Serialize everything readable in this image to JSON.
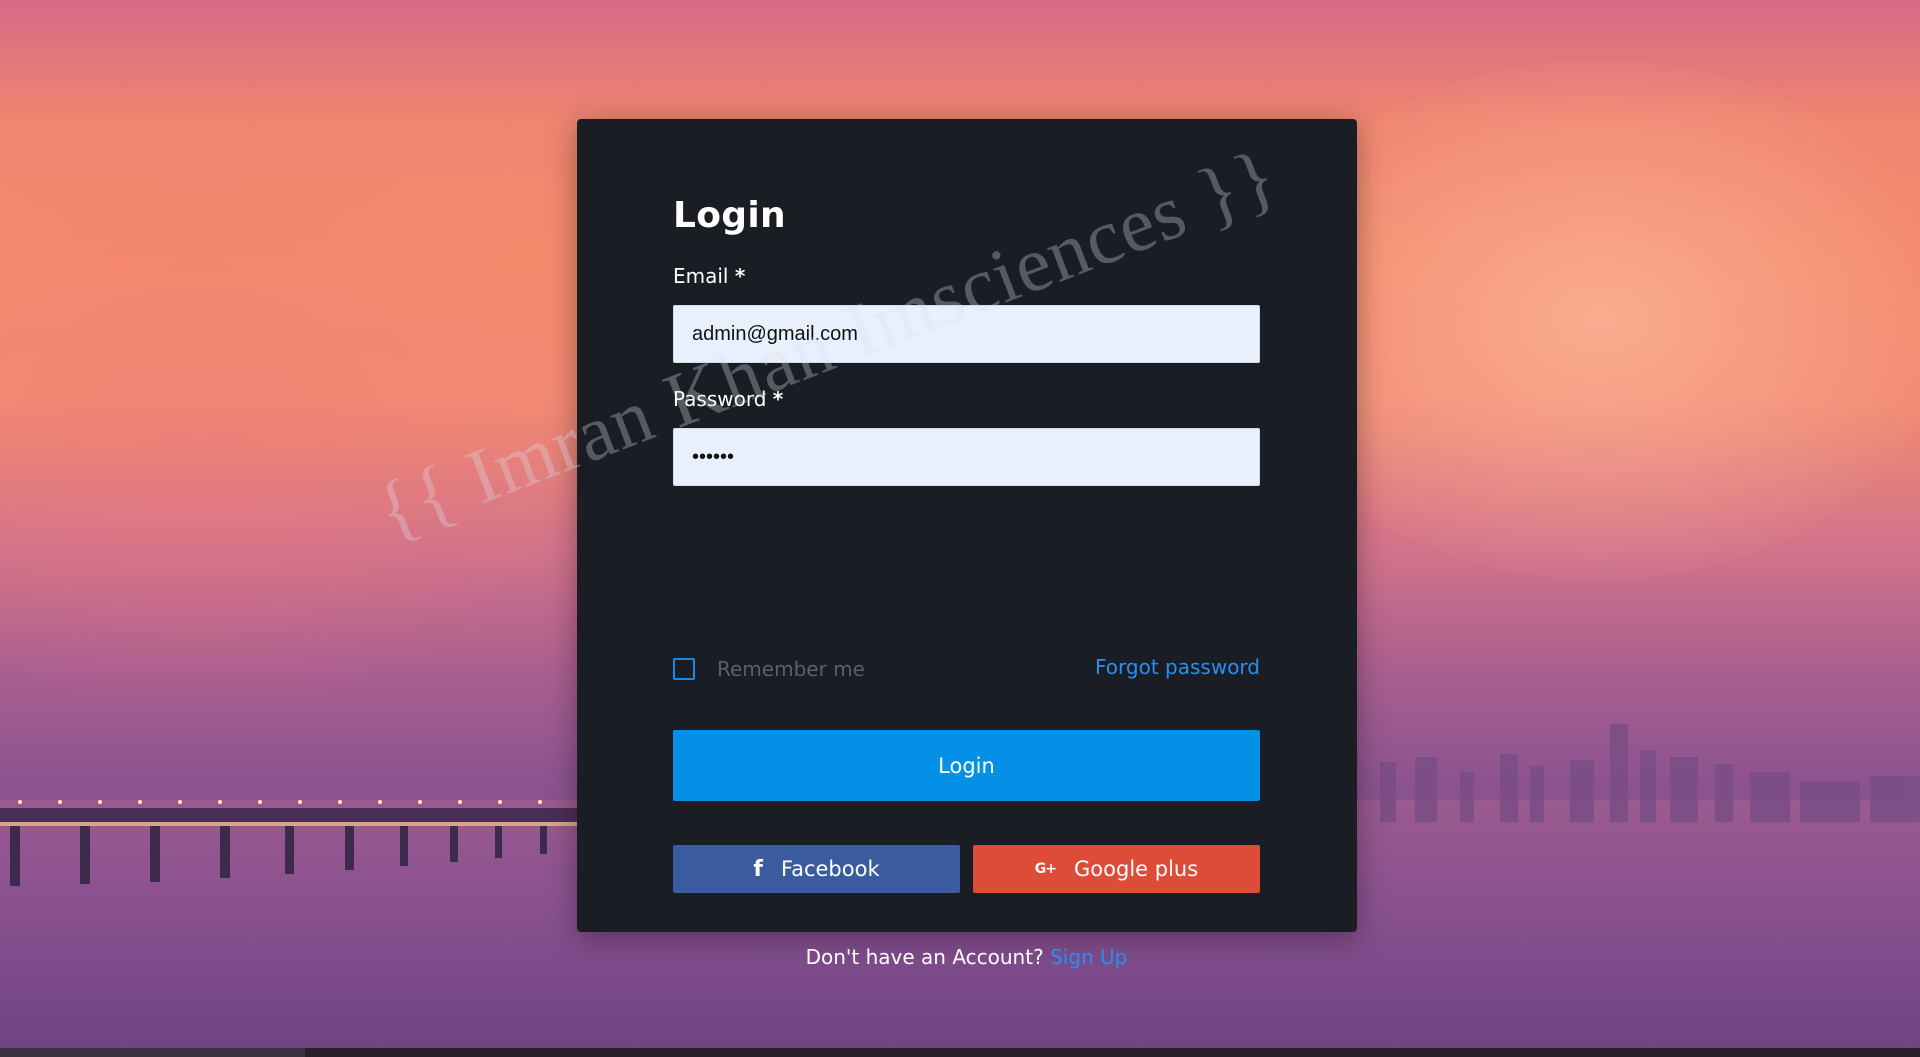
{
  "background": {
    "scene": "sunset-bay-background"
  },
  "login": {
    "title": "Login",
    "email": {
      "label": "Email",
      "required_marker": "*",
      "value": "admin@gmail.com"
    },
    "password": {
      "label": "Password",
      "required_marker": "*",
      "value": "••••••"
    },
    "remember_me": {
      "label": "Remember me",
      "checked": false
    },
    "forgot_password": "Forgot password",
    "submit_label": "Login",
    "social": {
      "facebook": {
        "label": "Facebook",
        "icon": "facebook-icon"
      },
      "google": {
        "label": "Google plus",
        "icon": "google-plus-icon"
      }
    },
    "signup": {
      "prompt": "Don't have an Account?",
      "link_label": "Sign Up"
    }
  },
  "watermark": {
    "text": "{{ Imran Khan Imsciences }}"
  },
  "colors": {
    "card_bg": "#1a1d24",
    "input_bg": "#e8f0fe",
    "primary": "#0490e6",
    "link": "#2a8ef5",
    "facebook": "#3b5b9f",
    "google": "#dd4b39"
  }
}
